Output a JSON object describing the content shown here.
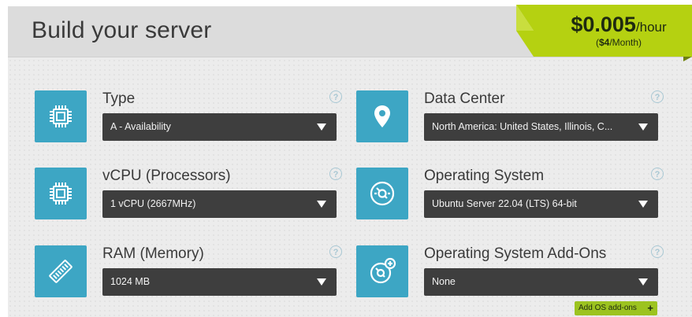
{
  "header": {
    "title": "Build your server"
  },
  "price": {
    "amount": "$0.005",
    "unit": "/hour",
    "monthly_prefix": "(",
    "monthly_amount": "$4",
    "monthly_suffix": "/Month)",
    "accent_color": "#b5d111"
  },
  "fields": [
    {
      "label": "Type",
      "value": "A - Availability",
      "icon": "cpu-chip-icon",
      "help": "?"
    },
    {
      "label": "Data Center",
      "value": "North America: United States, Illinois, C...",
      "icon": "location-pin-icon",
      "help": "?"
    },
    {
      "label": "vCPU (Processors)",
      "value": "1 vCPU (2667MHz)",
      "icon": "cpu-chip-icon",
      "help": "?"
    },
    {
      "label": "Operating System",
      "value": "Ubuntu Server 22.04 (LTS) 64-bit",
      "icon": "disc-icon",
      "help": "?"
    },
    {
      "label": "RAM (Memory)",
      "value": "1024 MB",
      "icon": "ram-stick-icon",
      "help": "?"
    },
    {
      "label": "Operating System Add-Ons",
      "value": "None",
      "icon": "disc-add-icon",
      "help": "?"
    }
  ],
  "addon_button": {
    "label": "Add OS add-ons",
    "plus": "+"
  },
  "colors": {
    "icon_bg": "#3da6c4",
    "select_bg": "#3e3e3e",
    "addon_btn": "#9cc320"
  }
}
